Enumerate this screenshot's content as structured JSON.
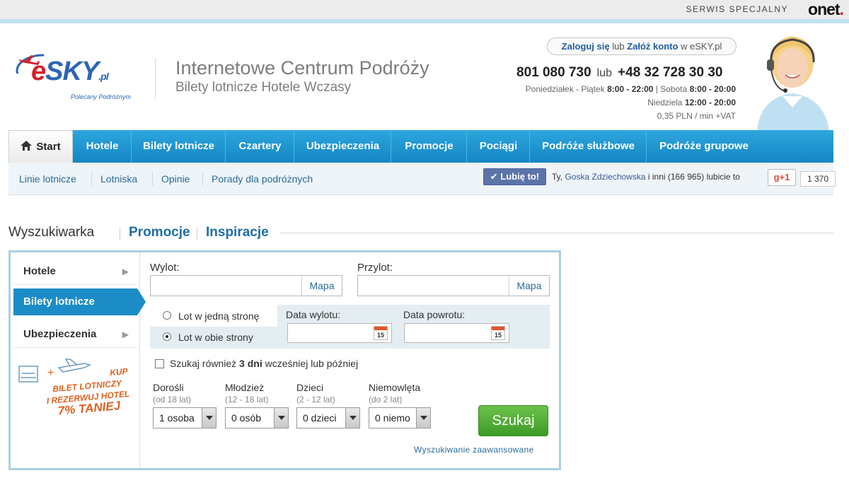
{
  "topbar": {
    "serwis": "SERWIS SPECJALNY",
    "onet": "onet"
  },
  "logo": {
    "name": "eSKY",
    "suffix": ".pl",
    "slogan": "Polecany Podróżnym"
  },
  "header": {
    "tagline": "Internetowe Centrum Podróży",
    "subtagline": "Bilety lotnicze Hotele Wczasy",
    "login": {
      "login_label": "Zaloguj się",
      "or": "lub",
      "register_label": "Załóż konto",
      "suffix": "w eSKY.pl"
    },
    "phone1": "801 080 730",
    "phone_sep": "lub",
    "phone2": "+48 32 728 30 30",
    "hours_week_label": "Poniedziałek - Piątek",
    "hours_week": "8:00 - 22:00",
    "hours_sat_label": "| Sobota",
    "hours_sat": "8:00 - 20:00",
    "hours_sun_label": "Niedziela",
    "hours_sun": "12:00 - 20:00",
    "price_note": "0,35 PLN / min +VAT"
  },
  "nav": {
    "items": [
      {
        "label": "Start"
      },
      {
        "label": "Hotele"
      },
      {
        "label": "Bilety lotnicze"
      },
      {
        "label": "Czartery"
      },
      {
        "label": "Ubezpieczenia"
      },
      {
        "label": "Promocje"
      },
      {
        "label": "Pociągi"
      },
      {
        "label": "Podróże służbowe"
      },
      {
        "label": "Podróże grupowe"
      }
    ]
  },
  "subnav": {
    "links": [
      {
        "label": "Linie lotnicze"
      },
      {
        "label": "Lotniska"
      },
      {
        "label": "Opinie"
      },
      {
        "label": "Porady dla podróżnych"
      }
    ]
  },
  "social": {
    "like_label": "Lubię to!",
    "like_prefix": "Ty,",
    "like_friend": "Goska Zdziechowska",
    "like_suffix": "i inni (166 965) lubicie to",
    "gplus_label": "g+1",
    "gplus_count": "1 370"
  },
  "search": {
    "tabs": [
      {
        "label": "Wyszukiwarka"
      },
      {
        "label": "Promocje"
      },
      {
        "label": "Inspiracje"
      }
    ],
    "sidebar": [
      {
        "label": "Hotele"
      },
      {
        "label": "Bilety lotnicze"
      },
      {
        "label": "Ubezpieczenia"
      }
    ],
    "promo": {
      "line1": "KUP",
      "line2": "BILET LOTNICZY",
      "line3": "I REZERWUJ HOTEL",
      "line4": "7% TANIEJ"
    },
    "wylot_label": "Wylot:",
    "przylot_label": "Przylot:",
    "wylot_value": "",
    "przylot_value": "",
    "mapa_label": "Mapa",
    "one_way_label": "Lot w jedną stronę",
    "round_trip_label": "Lot w obie strony",
    "date_out_label": "Data wylotu:",
    "date_back_label": "Data powrotu:",
    "date_out_value": "",
    "date_back_value": "",
    "calendar_day": "15",
    "flex_prefix": "Szukaj również",
    "flex_bold": "3 dni",
    "flex_suffix": "wcześniej lub później",
    "passengers": [
      {
        "label": "Dorośli",
        "sub": "(od 18 lat)",
        "value": "1 osoba"
      },
      {
        "label": "Młodzież",
        "sub": "(12 - 18 lat)",
        "value": "0 osób"
      },
      {
        "label": "Dzieci",
        "sub": "(2 - 12 lat)",
        "value": "0 dzieci"
      },
      {
        "label": "Niemowlęta",
        "sub": "(do 2 lat)",
        "value": "0 niemo"
      }
    ],
    "submit_label": "Szukaj",
    "advanced_label": "Wyszukiwanie zaawansowane"
  }
}
